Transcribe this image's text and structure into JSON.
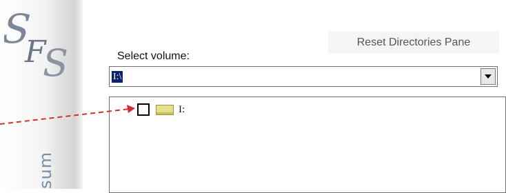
{
  "brand": {
    "logo_letters": "SFS",
    "vertical_text": "sum"
  },
  "directories": {
    "reset_button_label": "Reset Directories Pane",
    "volume_label": "Select volume:",
    "volume_value": "I:\\",
    "tree_items": [
      {
        "label": "I:",
        "checked": false
      }
    ]
  },
  "colors": {
    "selection_bg": "#0a246a",
    "arrow": "#d0312d",
    "drive_icon": "#e6e08a"
  },
  "icons": {
    "dropdown": "chevron-down-icon",
    "drive": "drive-icon",
    "pointer": "dashed-arrow"
  }
}
